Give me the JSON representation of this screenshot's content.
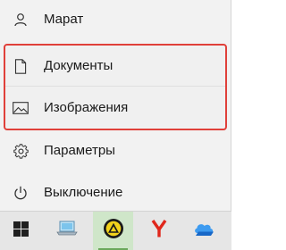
{
  "start_menu": {
    "items": [
      {
        "label": "Марат",
        "icon": "user-icon"
      },
      {
        "label": "Документы",
        "icon": "document-icon"
      },
      {
        "label": "Изображения",
        "icon": "pictures-icon"
      },
      {
        "label": "Параметры",
        "icon": "gear-icon"
      },
      {
        "label": "Выключение",
        "icon": "power-icon"
      }
    ],
    "highlight_color": "#e0403a"
  },
  "taskbar": {
    "apps": [
      {
        "name": "Windows",
        "icon": "windows-logo-icon"
      },
      {
        "name": "This PC",
        "icon": "laptop-icon"
      },
      {
        "name": "Active app",
        "icon": "yellow-black-app-icon",
        "active": true
      },
      {
        "name": "Yandex Browser",
        "icon": "yandex-icon"
      },
      {
        "name": "Cloud",
        "icon": "cloud-icon"
      }
    ]
  }
}
